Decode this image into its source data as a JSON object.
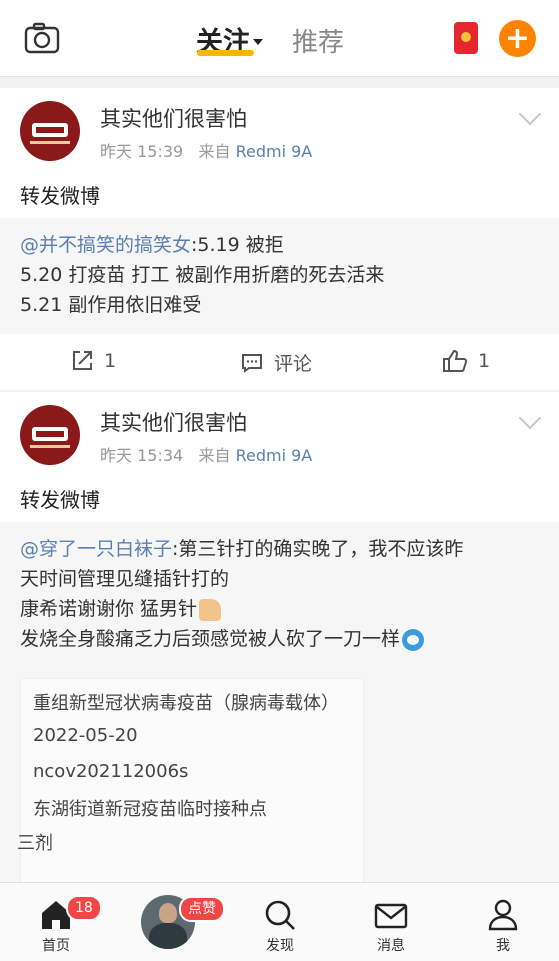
{
  "header": {
    "tab_follow": "关注",
    "tab_recommend": "推荐"
  },
  "posts": [
    {
      "username": "其实他们很害怕",
      "time": "昨天 15:39",
      "source_prefix": "来自",
      "device": "Redmi 9A",
      "text": "转发微博",
      "repost_mention": "@并不搞笑的搞笑女",
      "repost_lines": [
        ":5.19 被拒",
        "5.20 打疫苗 打工 被副作用折磨的死去活来",
        "5.21 副作用依旧难受"
      ],
      "share_count": "1",
      "comment_label": "评论",
      "like_count": "1"
    },
    {
      "username": "其实他们很害怕",
      "time": "昨天 15:34",
      "source_prefix": "来自",
      "device": "Redmi 9A",
      "text": "转发微博",
      "repost_mention": "@穿了一只白袜子",
      "repost_lines": [
        ":第三针打的确实晚了，我不应该昨",
        "天时间管理见缝插针打的",
        "康希诺谢谢你 猛男针",
        "发烧全身酸痛乏力后颈感觉被人砍了一刀一样"
      ],
      "image_lines": [
        "重组新型冠状病毒疫苗（腺病毒载体）",
        "2022-05-20",
        "ncov202112006s",
        "东湖街道新冠疫苗临时接种点",
        "三剂"
      ]
    }
  ],
  "bottom_nav": {
    "home": "首页",
    "home_badge": "18",
    "avatar_badge": "点赞",
    "discover": "发现",
    "messages": "消息",
    "me": "我"
  },
  "colors": {
    "accent": "#ff8200",
    "tab_underline": "#ffb400",
    "link": "#5b7fb0",
    "badge": "#f04646"
  }
}
